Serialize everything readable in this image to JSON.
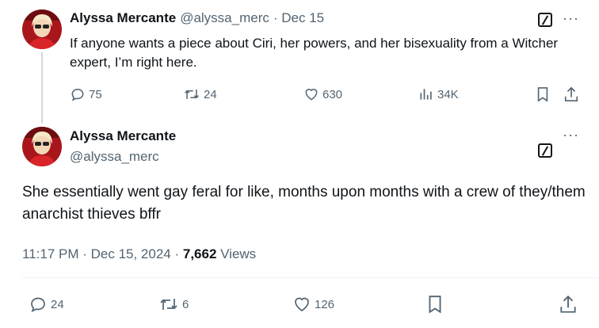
{
  "parent_tweet": {
    "author_name": "Alyssa Mercante",
    "handle": "@alyssa_merc",
    "date": "· Dec 15",
    "text": "If anyone wants a piece about Ciri, her powers, and her bisexuality from a Witcher expert, I’m right here.",
    "replies": "75",
    "retweets": "24",
    "likes": "630",
    "views": "34K"
  },
  "main_tweet": {
    "author_name": "Alyssa Mercante",
    "handle": "@alyssa_merc",
    "text": "She essentially went gay feral for like, months upon months with a crew of they/them anarchist thieves bffr",
    "time": "11:17 PM · Dec 15, 2024 · ",
    "views_count": "7,662",
    "views_label": " Views",
    "replies": "24",
    "retweets": "6",
    "likes": "126"
  },
  "icons": {
    "more": "···"
  },
  "colors": {
    "text": "#0f1419",
    "secondary": "#536471",
    "thread_line": "#cfd9de"
  }
}
